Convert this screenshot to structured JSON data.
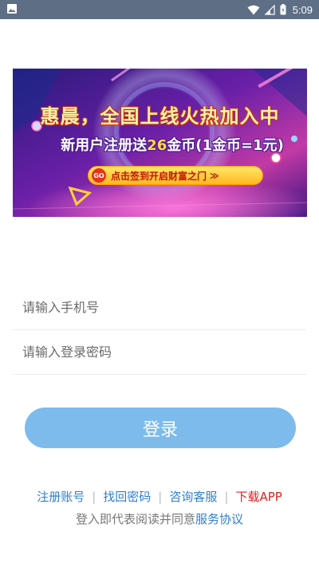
{
  "status_bar": {
    "time": "5:09",
    "icons": [
      "image-icon",
      "wifi-icon",
      "signal-icon",
      "battery-icon"
    ]
  },
  "banner": {
    "line1": "惠晨，全国上线火热加入中",
    "line2_prefix": "新用户注册送",
    "line2_highlight": "26",
    "line2_suffix": "金币(1金币=1元)",
    "go_badge": "GO",
    "go_text": "点击签到开启财富之门",
    "go_arrows": "≫"
  },
  "form": {
    "phone_placeholder": "请输入手机号",
    "phone_value": "",
    "password_placeholder": "请输入登录密码",
    "password_value": ""
  },
  "login_button": "登录",
  "links": {
    "register": "注册账号",
    "recover": "找回密码",
    "support": "咨询客服",
    "download": "下载APP",
    "separator": "|"
  },
  "agreement": {
    "prefix": "登入即代表阅读并同意",
    "link": "服务协议"
  },
  "colors": {
    "status_bar": "#5d6e85",
    "button": "#7dbbec",
    "link": "#2f7fd1",
    "download": "#e02020"
  }
}
